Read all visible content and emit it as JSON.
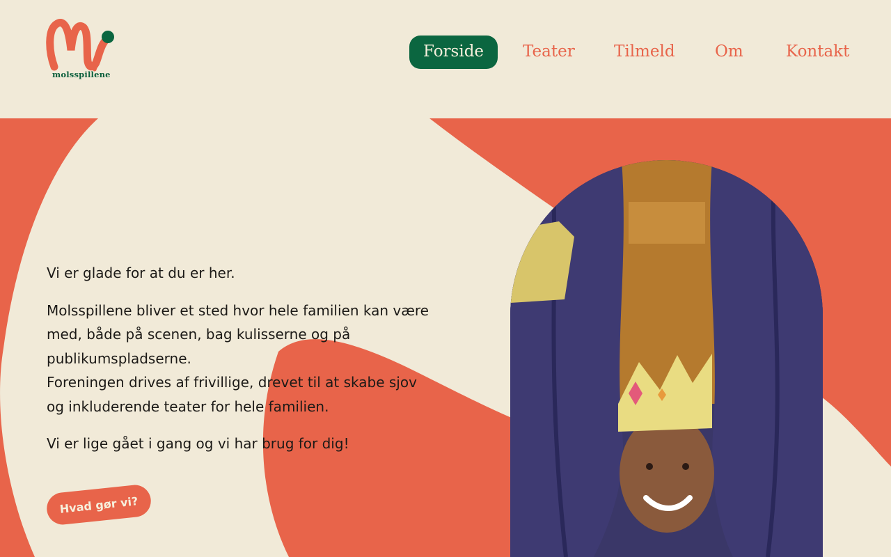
{
  "brand": {
    "name": "molsspillene",
    "colors": {
      "coral": "#e8644a",
      "green": "#0b6640",
      "cream": "#f1ead8",
      "purple": "#3a3768"
    }
  },
  "nav": {
    "items": [
      {
        "label": "Forside",
        "active": true
      },
      {
        "label": "Teater",
        "active": false
      },
      {
        "label": "Tilmeld",
        "active": false
      },
      {
        "label": "Om",
        "active": false
      },
      {
        "label": "Kontakt",
        "active": false
      }
    ]
  },
  "hero": {
    "intro": "Vi er glade for at du er her.",
    "body_line1": "Molsspillene bliver et sted hvor hele familien kan være med, både på scenen, bag kulisserne og på publikumspladserne.",
    "body_line2": "Foreningen drives af frivillige, drevet til at skabe sjov og inkluderende teater for hele familien.",
    "closing": "Vi er lige gået i gang og vi har brug for dig!",
    "cta_label": "Hvad gør vi?",
    "photo_icon": "child-with-paper-crown-photo"
  }
}
